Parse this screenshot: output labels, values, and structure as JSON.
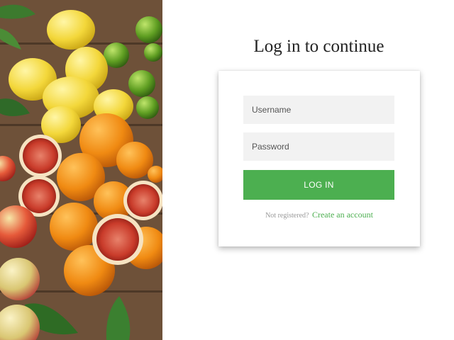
{
  "login": {
    "heading": "Log in to continue",
    "username_placeholder": "Username",
    "password_placeholder": "Password",
    "button_label": "LOG IN",
    "register_prompt": "Not registered?",
    "register_link": "Create an account"
  },
  "colors": {
    "accent": "#4caf50",
    "field_bg": "#f2f2f2",
    "heading": "#222222"
  },
  "images": {
    "side_photo": "citrus-fruit-photo"
  }
}
